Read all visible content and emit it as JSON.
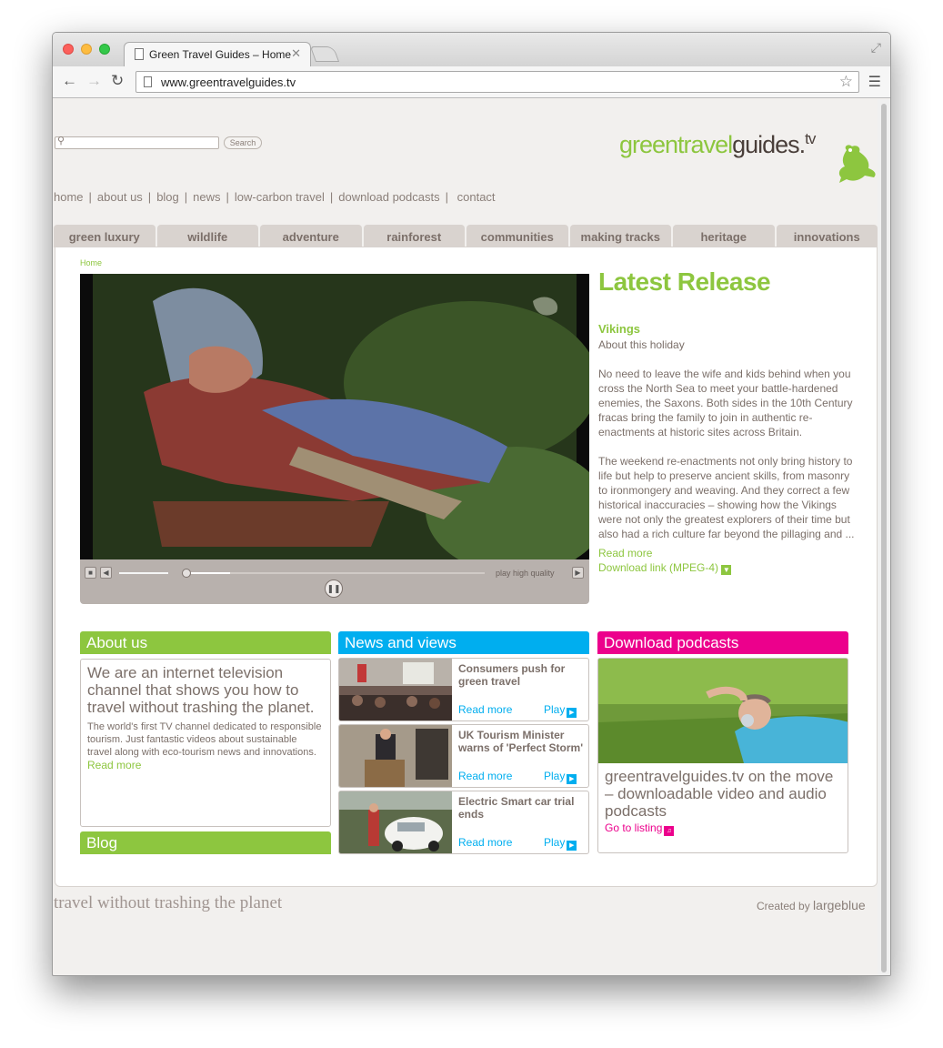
{
  "browser": {
    "tab_title": "Green Travel Guides – Home",
    "url": "www.greentravelguides.tv"
  },
  "header": {
    "search_placeholder": "",
    "search_button": "Search",
    "logo_green": "greentravel",
    "logo_dark": "guides.",
    "logo_tv": "tv"
  },
  "topnav": [
    "home",
    "about us",
    "blog",
    "news",
    "low-carbon travel",
    "download podcasts",
    "contact"
  ],
  "categories": [
    "green luxury",
    "wildlife",
    "adventure",
    "rainforest",
    "communities",
    "making tracks",
    "heritage",
    "innovations"
  ],
  "breadcrumb": "Home",
  "player": {
    "hq_label": "play high quality",
    "progress": 0.15,
    "volume": 1.0
  },
  "latest": {
    "heading": "Latest Release",
    "title": "Vikings",
    "subtitle": "About this holiday",
    "para1": "No need to leave the wife and kids behind when you cross the North Sea to meet your battle-hardened enemies, the Saxons. Both sides in the 10th Century fracas bring the family to join in authentic re-enactments at historic sites across Britain.",
    "para2": "The weekend re-enactments not only bring history to life but help to preserve ancient skills, from masonry to ironmongery and weaving. And they correct a few historical inaccuracies – showing how the Vikings were not only the greatest explorers of their time but also had a rich culture far beyond the pillaging and ...",
    "read_more": "Read more",
    "download": "Download link (MPEG-4)"
  },
  "about": {
    "heading": "About us",
    "big": "We are an internet television channel that shows you how to travel without trashing the planet.",
    "small": "The world's first TV channel dedicated to responsible tourism. Just fantastic videos about sustainable travel along with eco-tourism news and innovations.",
    "read_more": "Read more"
  },
  "blog": {
    "heading": "Blog"
  },
  "news": {
    "heading": "News and views",
    "items": [
      {
        "title": "Consumers push for green travel",
        "read": "Read more",
        "play": "Play"
      },
      {
        "title": "UK Tourism Minister warns of 'Perfect Storm'",
        "read": "Read more",
        "play": "Play"
      },
      {
        "title": "Electric Smart car trial ends",
        "read": "Read more",
        "play": "Play"
      }
    ]
  },
  "podcasts": {
    "heading": "Download podcasts",
    "text": "greentravelguides.tv on the move – downloadable video and audio podcasts",
    "link": "Go to listing"
  },
  "footer": {
    "tagline": "travel without trashing the planet",
    "created_by": "Created by",
    "company": "largeblue"
  },
  "colors": {
    "green": "#8dc63f",
    "blue": "#00aeef",
    "magenta": "#ec008c",
    "text": "#7b6f69"
  }
}
